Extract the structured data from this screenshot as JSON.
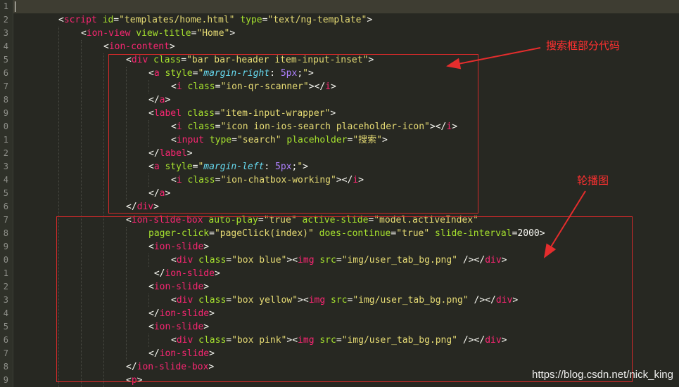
{
  "colors": {
    "background": "#272822",
    "tag": "#f92672",
    "attribute": "#a6e22e",
    "string": "#e6db74",
    "text": "#f8f8f2",
    "number": "#ae81ff",
    "css_property": "#66d9ef",
    "annotation": "#d32a2a"
  },
  "editor": {
    "line_numbers": [
      "1",
      "2",
      "3",
      "4",
      "5",
      "6",
      "7",
      "8",
      "9",
      "0",
      "1",
      "2",
      "3",
      "4",
      "5",
      "6",
      "7",
      "8",
      "9",
      "0",
      "1",
      "2",
      "3",
      "4",
      "5",
      "6",
      "7",
      "8",
      "9"
    ],
    "lines": [
      {
        "indent": 0,
        "tokens": []
      },
      {
        "indent": 1,
        "tokens": [
          {
            "t": "txt",
            "v": "<"
          },
          {
            "t": "tag",
            "v": "script"
          },
          {
            "t": "txt",
            "v": " "
          },
          {
            "t": "attr",
            "v": "id"
          },
          {
            "t": "txt",
            "v": "="
          },
          {
            "t": "str",
            "v": "\"templates/home.html\""
          },
          {
            "t": "txt",
            "v": " "
          },
          {
            "t": "attr",
            "v": "type"
          },
          {
            "t": "txt",
            "v": "="
          },
          {
            "t": "str",
            "v": "\"text/ng-template\""
          },
          {
            "t": "txt",
            "v": ">"
          }
        ]
      },
      {
        "indent": 2,
        "tokens": [
          {
            "t": "txt",
            "v": "<"
          },
          {
            "t": "tag",
            "v": "ion-view"
          },
          {
            "t": "txt",
            "v": " "
          },
          {
            "t": "attr",
            "v": "view-title"
          },
          {
            "t": "txt",
            "v": "="
          },
          {
            "t": "str",
            "v": "\"Home\""
          },
          {
            "t": "txt",
            "v": ">"
          }
        ]
      },
      {
        "indent": 3,
        "tokens": [
          {
            "t": "txt",
            "v": "<"
          },
          {
            "t": "tag",
            "v": "ion-content"
          },
          {
            "t": "txt",
            "v": ">"
          }
        ]
      },
      {
        "indent": 4,
        "tokens": [
          {
            "t": "txt",
            "v": "<"
          },
          {
            "t": "tag",
            "v": "div"
          },
          {
            "t": "txt",
            "v": " "
          },
          {
            "t": "attr",
            "v": "class"
          },
          {
            "t": "txt",
            "v": "="
          },
          {
            "t": "str",
            "v": "\"bar bar-header item-input-inset\""
          },
          {
            "t": "txt",
            "v": ">"
          }
        ]
      },
      {
        "indent": 5,
        "tokens": [
          {
            "t": "txt",
            "v": "<"
          },
          {
            "t": "tag",
            "v": "a"
          },
          {
            "t": "txt",
            "v": " "
          },
          {
            "t": "attr",
            "v": "style"
          },
          {
            "t": "txt",
            "v": "="
          },
          {
            "t": "str",
            "v": "\""
          },
          {
            "t": "prop",
            "v": "margin-right"
          },
          {
            "t": "txt",
            "v": ": "
          },
          {
            "t": "num",
            "v": "5px"
          },
          {
            "t": "txt",
            "v": ";"
          },
          {
            "t": "str",
            "v": "\""
          },
          {
            "t": "txt",
            "v": ">"
          }
        ]
      },
      {
        "indent": 6,
        "tokens": [
          {
            "t": "txt",
            "v": "<"
          },
          {
            "t": "tag",
            "v": "i"
          },
          {
            "t": "txt",
            "v": " "
          },
          {
            "t": "attr",
            "v": "class"
          },
          {
            "t": "txt",
            "v": "="
          },
          {
            "t": "str",
            "v": "\"ion-qr-scanner\""
          },
          {
            "t": "txt",
            "v": "></"
          },
          {
            "t": "tag",
            "v": "i"
          },
          {
            "t": "txt",
            "v": ">"
          }
        ]
      },
      {
        "indent": 5,
        "tokens": [
          {
            "t": "txt",
            "v": "</"
          },
          {
            "t": "tag",
            "v": "a"
          },
          {
            "t": "txt",
            "v": ">"
          }
        ]
      },
      {
        "indent": 5,
        "tokens": [
          {
            "t": "txt",
            "v": "<"
          },
          {
            "t": "tag",
            "v": "label"
          },
          {
            "t": "txt",
            "v": " "
          },
          {
            "t": "attr",
            "v": "class"
          },
          {
            "t": "txt",
            "v": "="
          },
          {
            "t": "str",
            "v": "\"item-input-wrapper\""
          },
          {
            "t": "txt",
            "v": ">"
          }
        ]
      },
      {
        "indent": 6,
        "tokens": [
          {
            "t": "txt",
            "v": "<"
          },
          {
            "t": "tag",
            "v": "i"
          },
          {
            "t": "txt",
            "v": " "
          },
          {
            "t": "attr",
            "v": "class"
          },
          {
            "t": "txt",
            "v": "="
          },
          {
            "t": "str",
            "v": "\"icon ion-ios-search placeholder-icon\""
          },
          {
            "t": "txt",
            "v": "></"
          },
          {
            "t": "tag",
            "v": "i"
          },
          {
            "t": "txt",
            "v": ">"
          }
        ]
      },
      {
        "indent": 6,
        "tokens": [
          {
            "t": "txt",
            "v": "<"
          },
          {
            "t": "tag",
            "v": "input"
          },
          {
            "t": "txt",
            "v": " "
          },
          {
            "t": "attr",
            "v": "type"
          },
          {
            "t": "txt",
            "v": "="
          },
          {
            "t": "str",
            "v": "\"search\""
          },
          {
            "t": "txt",
            "v": " "
          },
          {
            "t": "attr",
            "v": "placeholder"
          },
          {
            "t": "txt",
            "v": "="
          },
          {
            "t": "str",
            "v": "\"搜索\""
          },
          {
            "t": "txt",
            "v": ">"
          }
        ]
      },
      {
        "indent": 5,
        "tokens": [
          {
            "t": "txt",
            "v": "</"
          },
          {
            "t": "tag",
            "v": "label"
          },
          {
            "t": "txt",
            "v": ">"
          }
        ]
      },
      {
        "indent": 5,
        "tokens": [
          {
            "t": "txt",
            "v": "<"
          },
          {
            "t": "tag",
            "v": "a"
          },
          {
            "t": "txt",
            "v": " "
          },
          {
            "t": "attr",
            "v": "style"
          },
          {
            "t": "txt",
            "v": "="
          },
          {
            "t": "str",
            "v": "\""
          },
          {
            "t": "prop",
            "v": "margin-left"
          },
          {
            "t": "txt",
            "v": ": "
          },
          {
            "t": "num",
            "v": "5px"
          },
          {
            "t": "txt",
            "v": ";"
          },
          {
            "t": "str",
            "v": "\""
          },
          {
            "t": "txt",
            "v": ">"
          }
        ]
      },
      {
        "indent": 6,
        "tokens": [
          {
            "t": "txt",
            "v": "<"
          },
          {
            "t": "tag",
            "v": "i"
          },
          {
            "t": "txt",
            "v": " "
          },
          {
            "t": "attr",
            "v": "class"
          },
          {
            "t": "txt",
            "v": "="
          },
          {
            "t": "str",
            "v": "\"ion-chatbox-working\""
          },
          {
            "t": "txt",
            "v": "></"
          },
          {
            "t": "tag",
            "v": "i"
          },
          {
            "t": "txt",
            "v": ">"
          }
        ]
      },
      {
        "indent": 5,
        "tokens": [
          {
            "t": "txt",
            "v": "</"
          },
          {
            "t": "tag",
            "v": "a"
          },
          {
            "t": "txt",
            "v": ">"
          }
        ]
      },
      {
        "indent": 4,
        "tokens": [
          {
            "t": "txt",
            "v": "</"
          },
          {
            "t": "tag",
            "v": "div"
          },
          {
            "t": "txt",
            "v": ">"
          }
        ]
      },
      {
        "indent": 4,
        "tokens": [
          {
            "t": "txt",
            "v": "<"
          },
          {
            "t": "tag",
            "v": "ion-slide-box"
          },
          {
            "t": "txt",
            "v": " "
          },
          {
            "t": "attr",
            "v": "auto-play"
          },
          {
            "t": "txt",
            "v": "="
          },
          {
            "t": "str",
            "v": "\"true\""
          },
          {
            "t": "txt",
            "v": " "
          },
          {
            "t": "attr",
            "v": "active-slide"
          },
          {
            "t": "txt",
            "v": "="
          },
          {
            "t": "str",
            "v": "\"model.activeIndex\""
          }
        ]
      },
      {
        "indent": 5,
        "tokens": [
          {
            "t": "attr",
            "v": "pager-click"
          },
          {
            "t": "txt",
            "v": "="
          },
          {
            "t": "str",
            "v": "\"pageClick(index)\""
          },
          {
            "t": "txt",
            "v": " "
          },
          {
            "t": "attr",
            "v": "does-continue"
          },
          {
            "t": "txt",
            "v": "="
          },
          {
            "t": "str",
            "v": "\"true\""
          },
          {
            "t": "txt",
            "v": " "
          },
          {
            "t": "attr",
            "v": "slide-interval"
          },
          {
            "t": "txt",
            "v": "=2000>"
          }
        ]
      },
      {
        "indent": 5,
        "tokens": [
          {
            "t": "txt",
            "v": "<"
          },
          {
            "t": "tag",
            "v": "ion-slide"
          },
          {
            "t": "txt",
            "v": ">"
          }
        ]
      },
      {
        "indent": 6,
        "tokens": [
          {
            "t": "txt",
            "v": "<"
          },
          {
            "t": "tag",
            "v": "div"
          },
          {
            "t": "txt",
            "v": " "
          },
          {
            "t": "attr",
            "v": "class"
          },
          {
            "t": "txt",
            "v": "="
          },
          {
            "t": "str",
            "v": "\"box blue\""
          },
          {
            "t": "txt",
            "v": "><"
          },
          {
            "t": "tag",
            "v": "img"
          },
          {
            "t": "txt",
            "v": " "
          },
          {
            "t": "attr",
            "v": "src"
          },
          {
            "t": "txt",
            "v": "="
          },
          {
            "t": "str",
            "v": "\"img/user_tab_bg.png\""
          },
          {
            "t": "txt",
            "v": " /></"
          },
          {
            "t": "tag",
            "v": "div"
          },
          {
            "t": "txt",
            "v": ">"
          }
        ]
      },
      {
        "indent": 5,
        "tokens": [
          {
            "t": "txt",
            "v": " </"
          },
          {
            "t": "tag",
            "v": "ion-slide"
          },
          {
            "t": "txt",
            "v": ">"
          }
        ]
      },
      {
        "indent": 5,
        "tokens": [
          {
            "t": "txt",
            "v": "<"
          },
          {
            "t": "tag",
            "v": "ion-slide"
          },
          {
            "t": "txt",
            "v": ">"
          }
        ]
      },
      {
        "indent": 6,
        "tokens": [
          {
            "t": "txt",
            "v": "<"
          },
          {
            "t": "tag",
            "v": "div"
          },
          {
            "t": "txt",
            "v": " "
          },
          {
            "t": "attr",
            "v": "class"
          },
          {
            "t": "txt",
            "v": "="
          },
          {
            "t": "str",
            "v": "\"box yellow\""
          },
          {
            "t": "txt",
            "v": "><"
          },
          {
            "t": "tag",
            "v": "img"
          },
          {
            "t": "txt",
            "v": " "
          },
          {
            "t": "attr",
            "v": "src"
          },
          {
            "t": "txt",
            "v": "="
          },
          {
            "t": "str",
            "v": "\"img/user_tab_bg.png\""
          },
          {
            "t": "txt",
            "v": " /></"
          },
          {
            "t": "tag",
            "v": "div"
          },
          {
            "t": "txt",
            "v": ">"
          }
        ]
      },
      {
        "indent": 5,
        "tokens": [
          {
            "t": "txt",
            "v": "</"
          },
          {
            "t": "tag",
            "v": "ion-slide"
          },
          {
            "t": "txt",
            "v": ">"
          }
        ]
      },
      {
        "indent": 5,
        "tokens": [
          {
            "t": "txt",
            "v": "<"
          },
          {
            "t": "tag",
            "v": "ion-slide"
          },
          {
            "t": "txt",
            "v": ">"
          }
        ]
      },
      {
        "indent": 6,
        "tokens": [
          {
            "t": "txt",
            "v": "<"
          },
          {
            "t": "tag",
            "v": "div"
          },
          {
            "t": "txt",
            "v": " "
          },
          {
            "t": "attr",
            "v": "class"
          },
          {
            "t": "txt",
            "v": "="
          },
          {
            "t": "str",
            "v": "\"box pink\""
          },
          {
            "t": "txt",
            "v": "><"
          },
          {
            "t": "tag",
            "v": "img"
          },
          {
            "t": "txt",
            "v": " "
          },
          {
            "t": "attr",
            "v": "src"
          },
          {
            "t": "txt",
            "v": "="
          },
          {
            "t": "str",
            "v": "\"img/user_tab_bg.png\""
          },
          {
            "t": "txt",
            "v": " /></"
          },
          {
            "t": "tag",
            "v": "div"
          },
          {
            "t": "txt",
            "v": ">"
          }
        ]
      },
      {
        "indent": 5,
        "tokens": [
          {
            "t": "txt",
            "v": "</"
          },
          {
            "t": "tag",
            "v": "ion-slide"
          },
          {
            "t": "txt",
            "v": ">"
          }
        ]
      },
      {
        "indent": 4,
        "tokens": [
          {
            "t": "txt",
            "v": "</"
          },
          {
            "t": "tag",
            "v": "ion-slide-box"
          },
          {
            "t": "txt",
            "v": ">"
          }
        ]
      },
      {
        "indent": 4,
        "tokens": [
          {
            "t": "txt",
            "v": "<"
          },
          {
            "t": "tag",
            "v": "p"
          },
          {
            "t": "txt",
            "v": ">"
          }
        ]
      }
    ]
  },
  "annotations": {
    "search_label": "搜索框部分代码",
    "carousel_label": "轮播图"
  },
  "watermark": "https://blog.csdn.net/nick_king"
}
